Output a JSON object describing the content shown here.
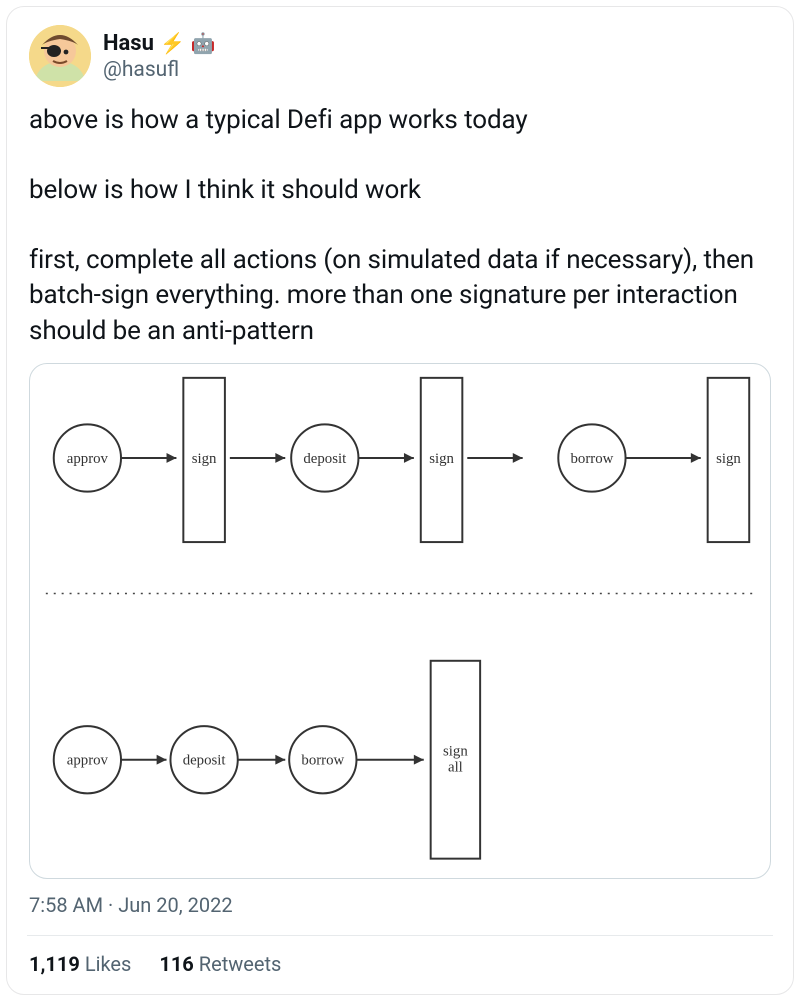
{
  "author": {
    "display_name": "Hasu",
    "emoji1": "⚡",
    "emoji2": "🤖",
    "handle": "@hasufl"
  },
  "body_text": "above is how a typical Defi app works today\n\nbelow is how I think it should work\n\nfirst, complete all actions (on simulated data if necessary), then batch-sign everything. more than one signature per interaction should be an anti-pattern",
  "diagram": {
    "top_flow": [
      {
        "type": "circle",
        "label": "approv"
      },
      {
        "type": "rect",
        "label": "sign"
      },
      {
        "type": "circle",
        "label": "deposit"
      },
      {
        "type": "rect",
        "label": "sign"
      },
      {
        "type": "circle",
        "label": "borrow"
      },
      {
        "type": "rect",
        "label": "sign"
      }
    ],
    "bottom_flow": [
      {
        "type": "circle",
        "label": "approv"
      },
      {
        "type": "circle",
        "label": "deposit"
      },
      {
        "type": "circle",
        "label": "borrow"
      },
      {
        "type": "rect",
        "label": "sign\nall"
      }
    ]
  },
  "timestamp": {
    "time": "7:58 AM",
    "sep": " · ",
    "date": "Jun 20, 2022"
  },
  "stats": {
    "likes_count": "1,119",
    "likes_label": "Likes",
    "retweets_count": "116",
    "retweets_label": "Retweets"
  }
}
